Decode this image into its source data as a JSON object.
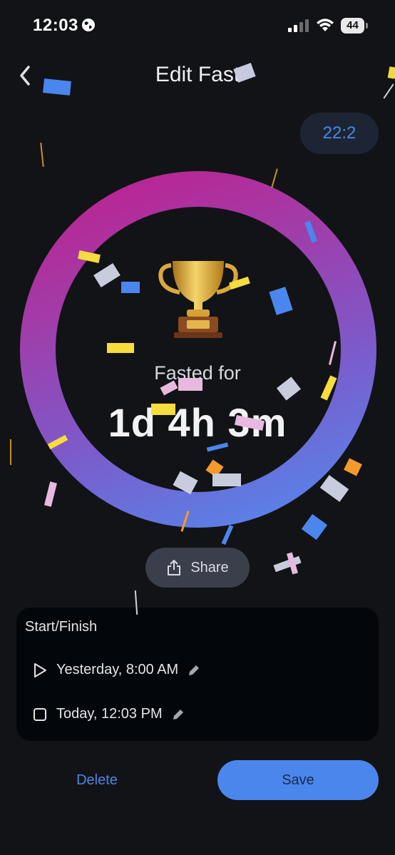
{
  "status_bar": {
    "time": "12:03",
    "battery": "44"
  },
  "header": {
    "title": "Edit Fast",
    "timer_badge": "22:2"
  },
  "progress": {
    "label": "Fasted for",
    "duration": "1d 4h 3m",
    "ring_colors": [
      "#c21d8a",
      "#4d8ef2"
    ]
  },
  "share": {
    "label": "Share"
  },
  "start_finish": {
    "title": "Start/Finish",
    "start": "Yesterday, 8:00 AM",
    "finish": "Today, 12:03 PM"
  },
  "actions": {
    "delete": "Delete",
    "save": "Save"
  },
  "colors": {
    "background": "#121316",
    "accent": "#4b86ec",
    "card": "#03060b"
  }
}
